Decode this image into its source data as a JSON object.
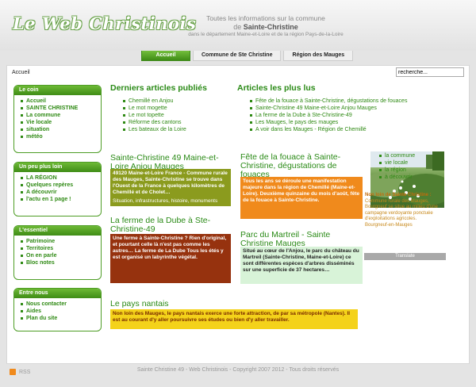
{
  "site": {
    "logo": "Le Web Christinois",
    "tagline1": "Toutes les informations sur la commune",
    "tagline2_prefix": "de",
    "tagline2": "Sainte-Christine",
    "tagline3": "dans le département Maine-et-Loire et de la région Pays-de-la-Loire"
  },
  "nav": [
    "Accueil",
    "Commune de Ste Christine",
    "Région des Mauges"
  ],
  "breadcrumb": "Accueil",
  "search": {
    "value": "recherche..."
  },
  "boxes": [
    {
      "title": "Le coin",
      "items": [
        "Accueil",
        "SAINTE CHRISTINE",
        "La commune",
        "Vie locale",
        "situation",
        "météo"
      ]
    },
    {
      "title": "Un peu plus loin",
      "items": [
        "LA RÉGION",
        "Quelques repères",
        "A découvrir",
        "l'actu en 1 page !"
      ]
    },
    {
      "title": "L'essentiel",
      "items": [
        "Patrimoine",
        "Territoires",
        "On en parle",
        "Bloc notes"
      ]
    },
    {
      "title": "Entre nous",
      "items": [
        "Nous contacter",
        "Aides",
        "Plan du site"
      ]
    }
  ],
  "latest": {
    "title": "Derniers articles publiés",
    "items": [
      "Chemillé en Anjou",
      "Le mot mogette",
      "Le mot topette",
      "Réforme des cantons",
      "Les bateaux de la Loire"
    ]
  },
  "mostread": {
    "title": "Articles les plus lus",
    "items": [
      "Fête de la fouace à Sainte-Christine, dégustations de fouaces",
      "Sainte-Christine 49 Maine-et-Loire Anjou Mauges",
      "La ferme de la Dube à Ste-Christine-49",
      "Les Mauges, le pays des mauges",
      "A voir dans les Mauges - Région de Chemillé"
    ]
  },
  "cards": [
    {
      "title": "Sainte-Christine 49 Maine-et-Loire Anjou Mauges",
      "text": "49120 Maine-et-Loire France - Commune rurale des Mauges, Sainte-Christine se trouve dans l'Ouest de la France à quelques kilomètres de Chemillé et de Cholet…",
      "footer": "Situation, infrastructures, histoire, monuments",
      "color": "#8b9b1e"
    },
    {
      "title": "Fête de la fouace à Sainte-Christine, dégustations de fouaces",
      "text": "Tous les ans se déroule une manifestation majeure dans la région de Chemillé (Maine-et-Loire). Deuxième quinzaine du mois d'août, fête de la fouace à Sainte-Christine.",
      "color": "#f08a1c"
    },
    {
      "title": "La ferme de la Dube à Ste-Christine-49",
      "text": "Une ferme à Sainte-Christine ? Rien d'original, et pourtant celle là n'est pas comme les autres… La ferme de La Dube Tous les étés y est organisé un labyrinthe végétal.",
      "color": "#96320e"
    },
    {
      "title": "Parc du Martreil - Sainte Christine Mauges",
      "text": "Situé au cœur de l'Anjou, le parc du château du Martreil (Sainte-Christine, Maine-et-Loire) ce sont différentes espèces d'arbres disséminés sur une superficie de 37 hectares…",
      "color": "#d8f3d8"
    },
    {
      "title": "Le pays nantais",
      "text": "Non loin des Mauges, le pays nantais exerce une forte attraction, de par sa métropole (Nantes). Il est au courant d'y aller poursuivre ses études ou bien d'y aller travailler.",
      "color": "#f4d21a"
    }
  ],
  "side": {
    "links": [
      "la commune",
      "vie locale",
      "la région",
      "à découvrir"
    ],
    "near_title": "Non loin de Sainte Christine :",
    "near_text": "Commune rurale des Mauges, Bourgneuf se situe au milieu d'une campagne verdoyante ponctuée d'exploitations agricoles.",
    "near_link": "Bourgneuf-en-Mauges",
    "translate": "Translate"
  },
  "footer": {
    "rss": "RSS",
    "copy": "Sainte Christine 49 - Web Christinois - Copyright 2007 2012 - Tous droits réservés"
  }
}
